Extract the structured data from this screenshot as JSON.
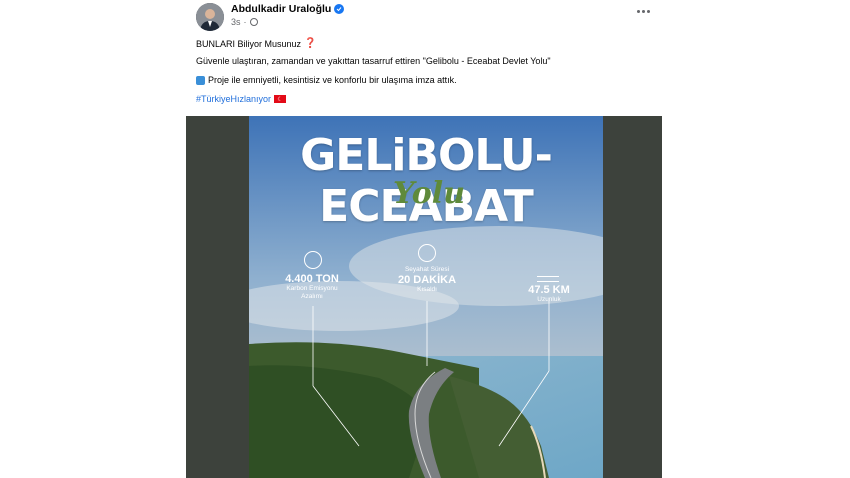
{
  "post": {
    "author": "Abdulkadir Uraloğlu",
    "time": "3s",
    "more_label": "•••",
    "lines": {
      "l1_text": "BUNLARI Biliyor Musunuz",
      "l1_emoji": "❓",
      "l2_text": "Güvenle ulaştıran, zamandan ve yakıttan tasarruf ettiren \"Gelibolu - Eceabat Devlet Yolu\"",
      "l3_text": "Proje ile emniyetli, kesintisiz ve konforlu bir ulaşıma imza attık.",
      "l4_hashtag": "#TürkiyeHızlanıyor"
    }
  },
  "poster": {
    "title": "GELiBOLU-ECEABAT",
    "script": "Yolu",
    "stats": [
      {
        "value": "4.400 TON",
        "sub1": "Karbon Emisyonu",
        "sub2": "Azalımı"
      },
      {
        "value": "20 DAKİKA",
        "pre": "Seyahat Süresi",
        "sub1": "Kısaldı"
      },
      {
        "value": "47.5 KM",
        "sub1": "Uzunluk"
      }
    ]
  },
  "colors": {
    "link": "#216fdb",
    "verified": "#1877f2",
    "media_bg": "#3d423c"
  }
}
